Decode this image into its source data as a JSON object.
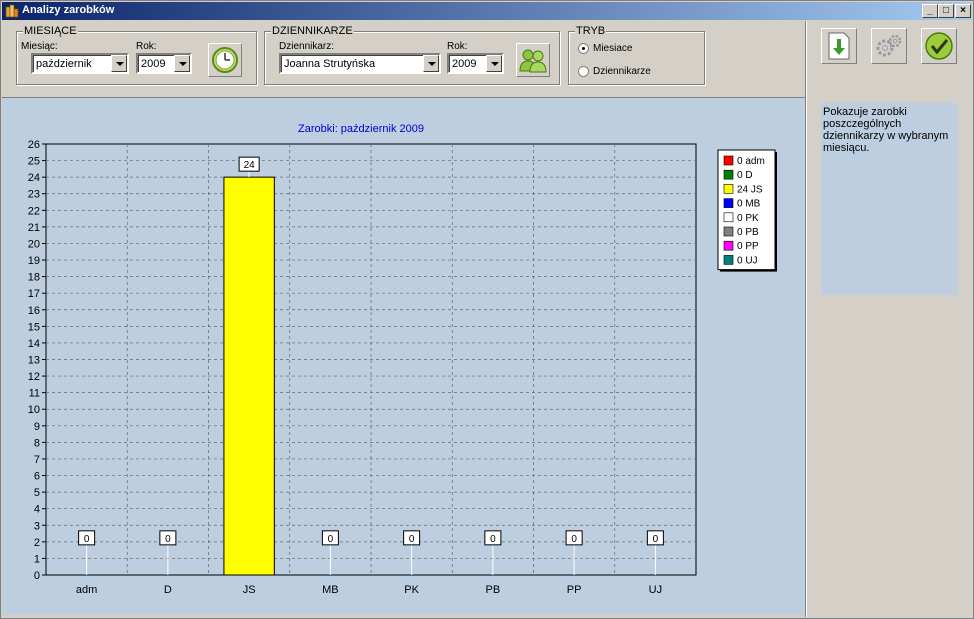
{
  "window": {
    "title": "Analizy zarobków",
    "min_label": "_",
    "max_label": "□",
    "close_label": "×"
  },
  "miesiace": {
    "legend": "MIESIĄCE",
    "month_label": "Miesiąc:",
    "month_value": "październik",
    "year_label": "Rok:",
    "year_value": "2009",
    "button_icon": "clock-icon"
  },
  "dziennikarze": {
    "legend": "DZIENNIKARZE",
    "journalist_label": "Dziennikarz:",
    "journalist_value": "Joanna Strutyńska",
    "year_label": "Rok:",
    "year_value": "2009",
    "button_icon": "users-icon"
  },
  "tryb": {
    "legend": "TRYB",
    "options": [
      {
        "label": "Miesiace",
        "selected": true
      },
      {
        "label": "Dziennikarze",
        "selected": false
      }
    ]
  },
  "toolbar": {
    "export_icon": "download-icon",
    "settings_icon": "gear-icon",
    "ok_icon": "check-icon"
  },
  "info_text": "Pokazuje zarobki poszczególnych dziennikarzy w wybranym miesiącu.",
  "chart_data": {
    "type": "bar",
    "title": "Zarobki: październik 2009",
    "categories": [
      "adm",
      "D",
      "JS",
      "MB",
      "PK",
      "PB",
      "PP",
      "UJ"
    ],
    "values": [
      0,
      0,
      24,
      0,
      0,
      0,
      0,
      0
    ],
    "colors": [
      "#ff0000",
      "#008000",
      "#ffff00",
      "#0000ff",
      "#ffffff",
      "#808080",
      "#ff00ff",
      "#008080"
    ],
    "ylim": [
      0,
      26
    ],
    "yticks": [
      0,
      1,
      2,
      3,
      4,
      5,
      6,
      7,
      8,
      9,
      10,
      11,
      12,
      13,
      14,
      15,
      16,
      17,
      18,
      19,
      20,
      21,
      22,
      23,
      24,
      25,
      26
    ],
    "grid": true,
    "legend": "top-right",
    "legend_entries": [
      "0 adm",
      "0 D",
      "24 JS",
      "0 MB",
      "0 PK",
      "0 PB",
      "0 PP",
      "0 UJ"
    ]
  }
}
